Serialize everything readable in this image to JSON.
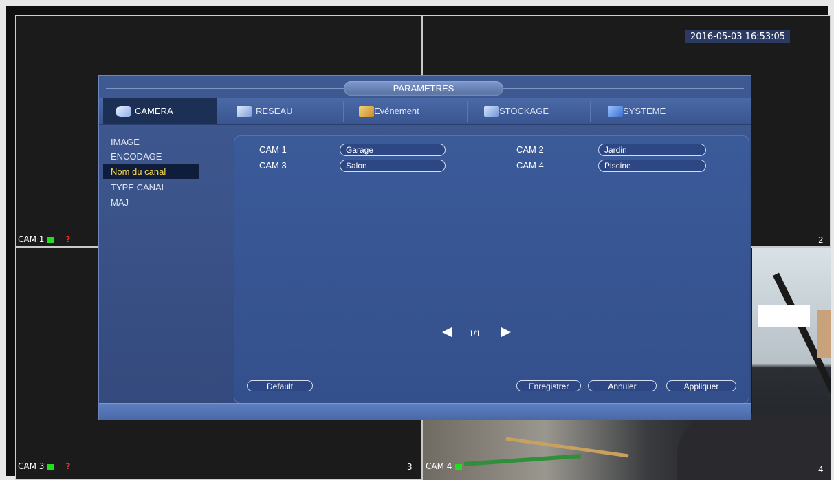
{
  "timestamp": "2016-05-03 16:53:05",
  "tiles": {
    "cam1_label": "CAM 1",
    "cam3_label": "CAM 3",
    "cam4_label": "CAM 4",
    "tile2_number": "2",
    "tile3_number": "3",
    "tile4_number": "4",
    "unknown_mark": "?"
  },
  "dialog": {
    "title": "PARAMETRES",
    "tabs": [
      {
        "label": "CAMERA",
        "icon": "camera-icon",
        "active": true
      },
      {
        "label": "RESEAU",
        "icon": "network-icon"
      },
      {
        "label": "Evénement",
        "icon": "event-icon"
      },
      {
        "label": "STOCKAGE",
        "icon": "storage-icon"
      },
      {
        "label": "SYSTEME",
        "icon": "system-icon"
      }
    ],
    "sidebar": [
      {
        "label": "IMAGE"
      },
      {
        "label": "ENCODAGE"
      },
      {
        "label": "Nom du canal",
        "active": true
      },
      {
        "label": "TYPE CANAL"
      },
      {
        "label": "MAJ"
      }
    ],
    "channels": [
      {
        "label": "CAM 1",
        "value": "Garage"
      },
      {
        "label": "CAM 2",
        "value": "Jardin"
      },
      {
        "label": "CAM 3",
        "value": "Salon"
      },
      {
        "label": "CAM 4",
        "value": "Piscine"
      }
    ],
    "pager": "1/1",
    "buttons": {
      "default": "Default",
      "save": "Enregistrer",
      "cancel": "Annuler",
      "apply": "Appliquer"
    }
  }
}
